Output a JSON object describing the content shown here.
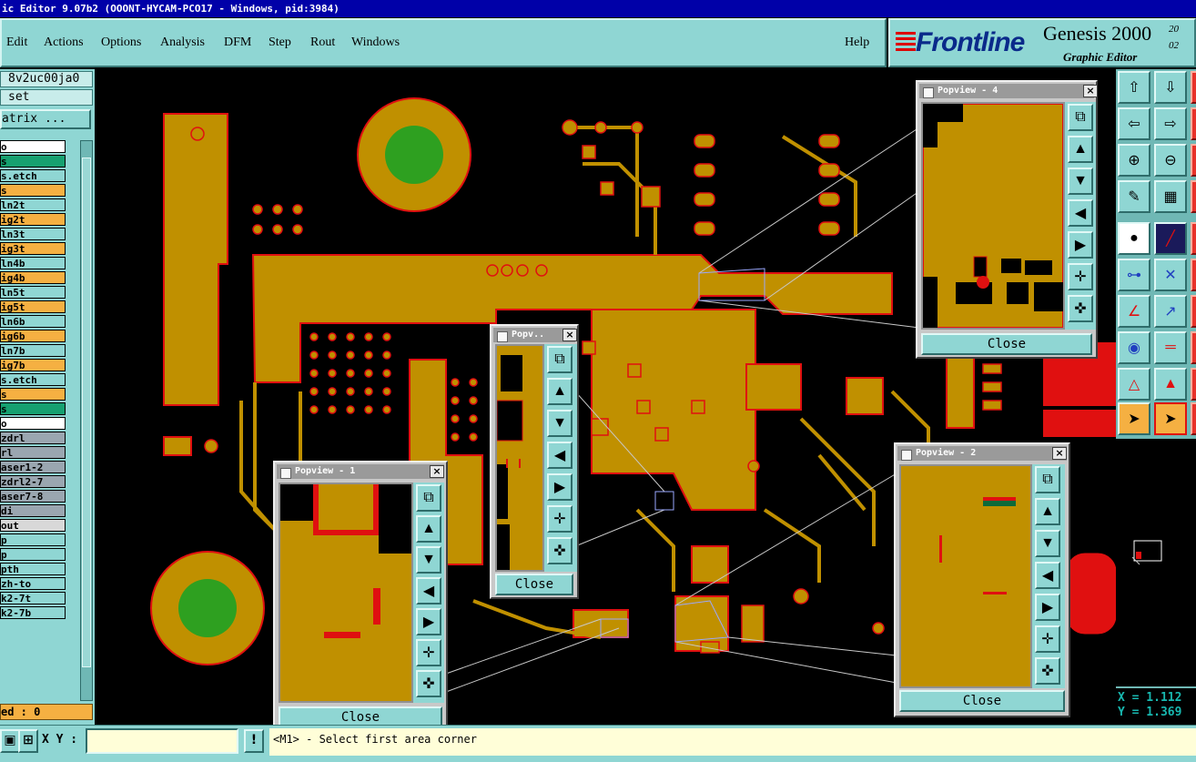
{
  "window": {
    "title": "ic Editor 9.07b2 (OOONT-HYCAM-PCO17 - Windows, pid:3984)"
  },
  "menu": {
    "items": [
      "Edit",
      "Actions",
      "Options",
      "Analysis",
      "DFM",
      "Step",
      "Rout",
      "Windows"
    ],
    "help": "Help"
  },
  "brand": {
    "logo": "Frontline",
    "product": "Genesis 2000",
    "subtitle": "Graphic Editor",
    "date_line1": "20",
    "date_line2": "02"
  },
  "left_panel": {
    "job_name": "8v2uc00ja0",
    "step_label": "set",
    "matrix_button": "atrix ...",
    "layers": [
      {
        "name": "o",
        "color": "#ffffff"
      },
      {
        "name": "s",
        "color": "#16a070"
      },
      {
        "name": "s.etch",
        "color": "#8fd6d3"
      },
      {
        "name": "s",
        "color": "#f5b042"
      },
      {
        "name": "ln2t",
        "color": "#8fd6d3"
      },
      {
        "name": "ig2t",
        "color": "#f5b042"
      },
      {
        "name": "ln3t",
        "color": "#8fd6d3"
      },
      {
        "name": "ig3t",
        "color": "#f5b042"
      },
      {
        "name": "ln4b",
        "color": "#8fd6d3"
      },
      {
        "name": "ig4b",
        "color": "#f5b042"
      },
      {
        "name": "ln5t",
        "color": "#8fd6d3"
      },
      {
        "name": "ig5t",
        "color": "#f5b042"
      },
      {
        "name": "ln6b",
        "color": "#8fd6d3"
      },
      {
        "name": "ig6b",
        "color": "#f5b042"
      },
      {
        "name": "ln7b",
        "color": "#8fd6d3"
      },
      {
        "name": "ig7b",
        "color": "#f5b042"
      },
      {
        "name": "s.etch",
        "color": "#8fd6d3"
      },
      {
        "name": "s",
        "color": "#f5b042"
      },
      {
        "name": "s",
        "color": "#16a070"
      },
      {
        "name": "o",
        "color": "#ffffff"
      },
      {
        "name": "zdrl",
        "color": "#9aa6b0"
      },
      {
        "name": "rl",
        "color": "#9aa6b0"
      },
      {
        "name": "aser1-2",
        "color": "#9aa6b0"
      },
      {
        "name": "zdrl2-7",
        "color": "#9aa6b0"
      },
      {
        "name": "aser7-8",
        "color": "#9aa6b0"
      },
      {
        "name": "di",
        "color": "#9aa6b0"
      },
      {
        "name": "out",
        "color": "#d8d8d8"
      },
      {
        "name": "p",
        "color": "#8fd6d3"
      },
      {
        "name": "p",
        "color": "#8fd6d3"
      },
      {
        "name": "pth",
        "color": "#8fd6d3"
      },
      {
        "name": "zh-to",
        "color": "#8fd6d3"
      },
      {
        "name": "k2-7t",
        "color": "#8fd6d3"
      },
      {
        "name": "k2-7b",
        "color": "#8fd6d3"
      }
    ],
    "affected": "ed : 0"
  },
  "popviews": [
    {
      "title": "Popview - 4",
      "close_label": "Close"
    },
    {
      "title": "Popv..",
      "close_label": "Close"
    },
    {
      "title": "Popview - 1",
      "close_label": "Close"
    },
    {
      "title": "Popview - 2",
      "close_label": "Close"
    }
  ],
  "coords": {
    "x": "X = 1.112",
    "y": "Y = 1.369"
  },
  "statusbar": {
    "xy_label": "X Y :",
    "xy_value": "",
    "warn_icon": "!",
    "prompt": "<M1> - Select first area corner"
  },
  "colors": {
    "copper": "#c09000",
    "pad_outline": "#e01010",
    "drill": "#2ea020",
    "ui_teal": "#8fd6d3",
    "title_blue": "#0000a8"
  }
}
